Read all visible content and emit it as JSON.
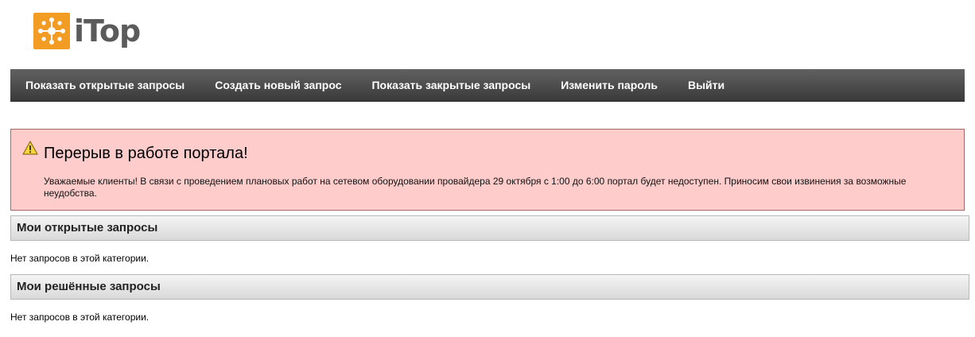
{
  "logo": {
    "text": "iTop",
    "brand_color": "#f39c24",
    "text_color": "#5b5b5b"
  },
  "nav": {
    "items": [
      {
        "label": "Показать открытые запросы"
      },
      {
        "label": "Создать новый запрос"
      },
      {
        "label": "Показать закрытые запросы"
      },
      {
        "label": "Изменить пароль"
      },
      {
        "label": "Выйти"
      }
    ]
  },
  "alert": {
    "icon": "warning-icon",
    "title": "Перерыв в работе портала!",
    "message": "Уважаемые клиенты! В связи с проведением плановых работ на сетевом оборудовании провайдера 29 октября с 1:00 до 6:00 портал будет недоступен. Приносим свои извинения за возможные неудобства.",
    "background": "#ffcccc"
  },
  "sections": [
    {
      "title": "Мои открытые запросы",
      "empty_text": "Нет запросов в этой категории."
    },
    {
      "title": "Мои решённые запросы",
      "empty_text": "Нет запросов в этой категории."
    }
  ]
}
